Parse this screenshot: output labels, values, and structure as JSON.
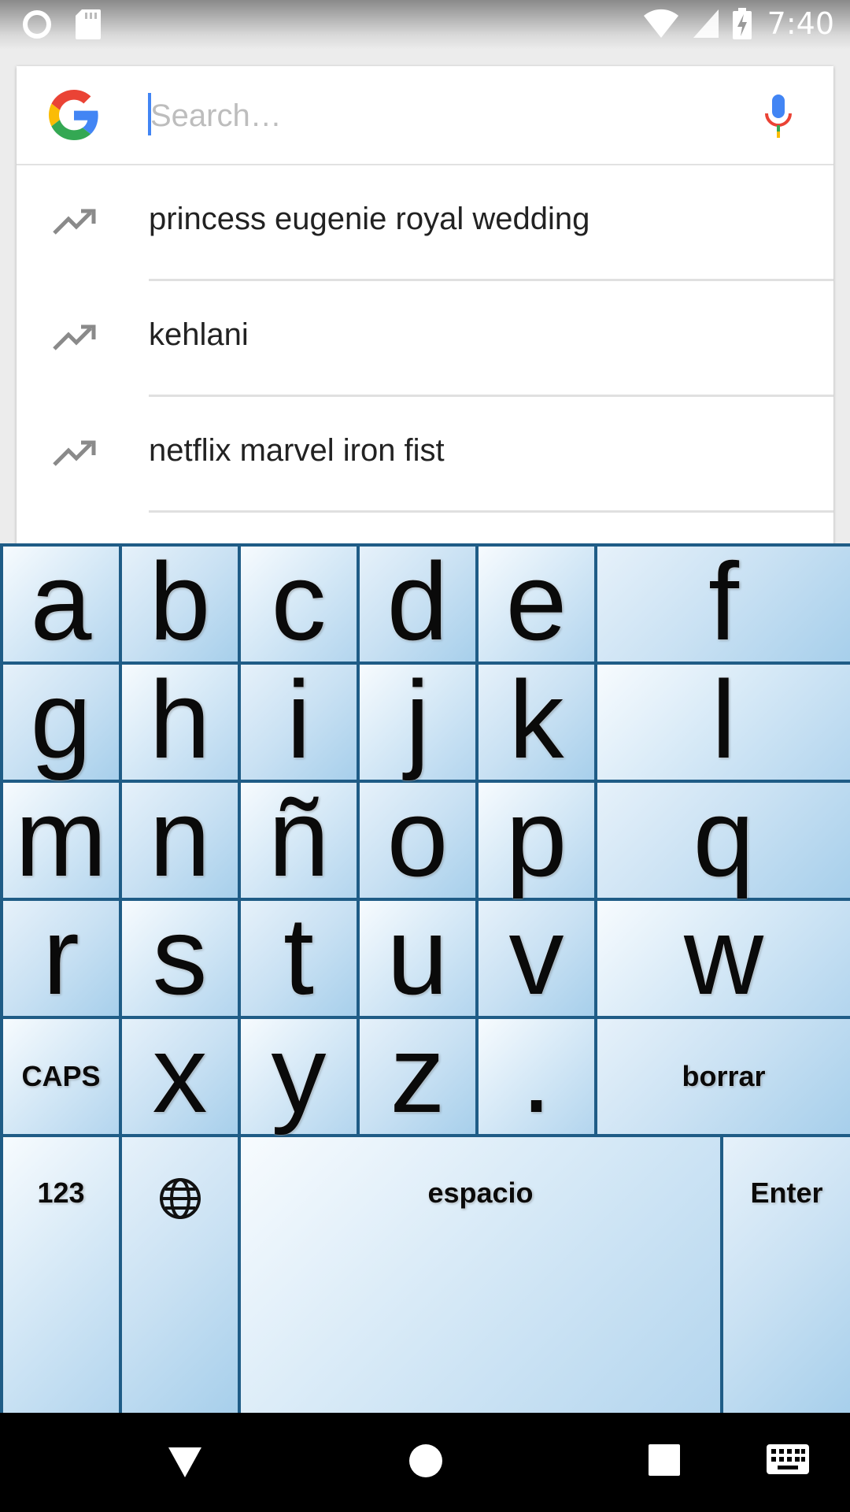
{
  "status_bar": {
    "time": "7:40",
    "icons": [
      "circle-notification-icon",
      "sd-card-icon",
      "wifi-icon",
      "cell-signal-icon",
      "battery-charging-icon"
    ]
  },
  "search": {
    "placeholder": "Search…",
    "value": "",
    "logo": "google-g-icon",
    "mic": "microphone-icon"
  },
  "suggestions": [
    {
      "label": "princess eugenie royal wedding",
      "icon": "trending-icon"
    },
    {
      "label": "kehlani",
      "icon": "trending-icon"
    },
    {
      "label": "netflix marvel iron fist",
      "icon": "trending-icon"
    }
  ],
  "keyboard": {
    "rows": [
      [
        "a",
        "b",
        "c",
        "d",
        "e",
        "f"
      ],
      [
        "g",
        "h",
        "i",
        "j",
        "k",
        "l"
      ],
      [
        "m",
        "n",
        "ñ",
        "o",
        "p",
        "q"
      ],
      [
        "r",
        "s",
        "t",
        "u",
        "v",
        "w"
      ],
      [
        "CAPS",
        "x",
        "y",
        "z",
        ".",
        "borrar"
      ]
    ],
    "bottom": {
      "numbers": "123",
      "language": "globe-icon",
      "space": "espacio",
      "enter": "Enter"
    },
    "border_color": "#1f5c86"
  },
  "nav_bar": {
    "icons": [
      "back-icon",
      "home-icon",
      "recents-icon",
      "keyboard-switch-icon"
    ]
  }
}
